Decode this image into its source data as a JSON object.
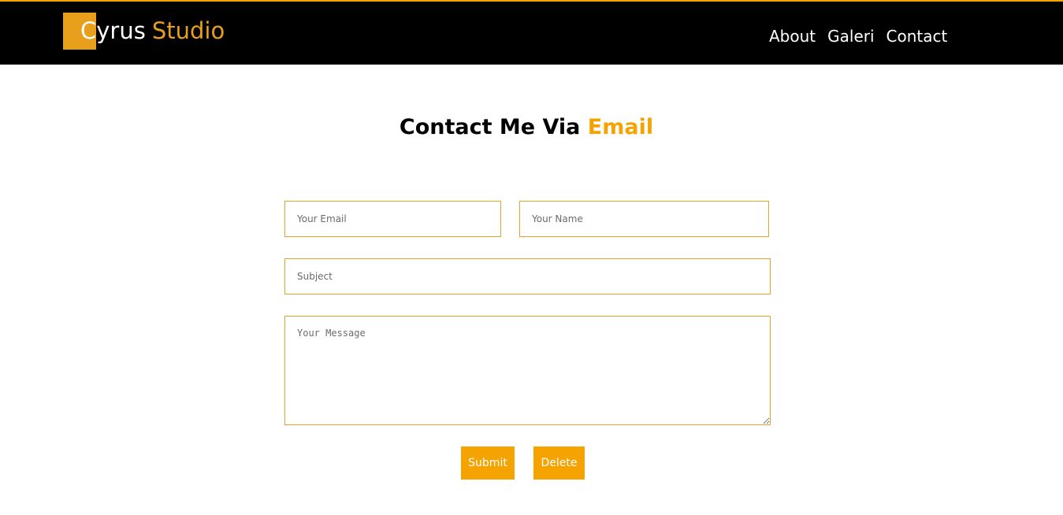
{
  "colors": {
    "accent": "#f5a300",
    "header_bg": "#000000",
    "border": "#e0a526"
  },
  "header": {
    "logo_first": "Cyrus",
    "logo_second": "Studio",
    "nav": [
      "About",
      "Galeri",
      "Contact"
    ]
  },
  "main": {
    "title_prefix": "Contact Me Via",
    "title_accent": "Email"
  },
  "form": {
    "email_placeholder": "Your Email",
    "name_placeholder": "Your Name",
    "subject_placeholder": "Subject",
    "message_placeholder": "Your Message",
    "submit_label": "Submit",
    "delete_label": "Delete"
  }
}
